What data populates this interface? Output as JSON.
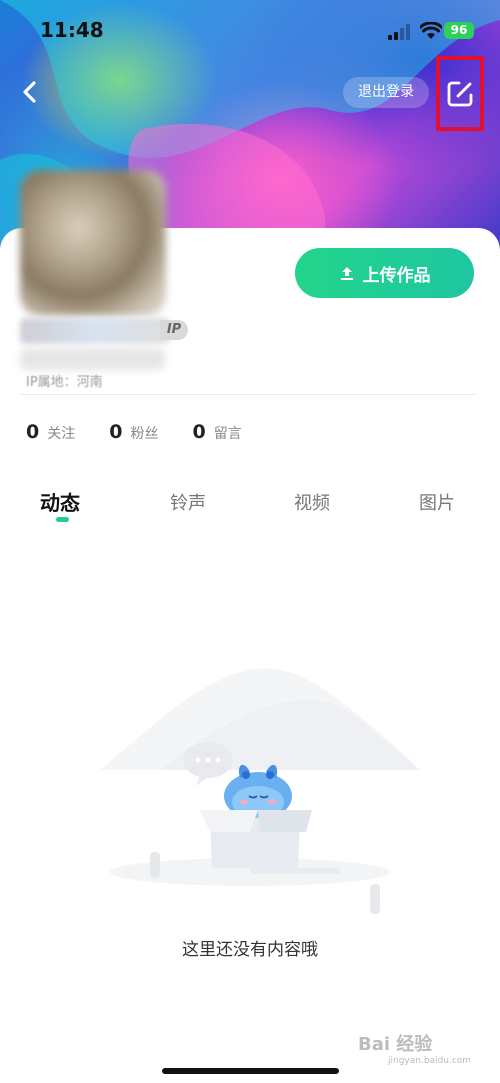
{
  "status_bar": {
    "time": "11:48",
    "battery": "96"
  },
  "header": {
    "logout_label": "退出登录"
  },
  "profile": {
    "upload_label": "上传作品",
    "vip_badge": "IP",
    "ip_location": "IP属地：河南",
    "stats": [
      {
        "value": "0",
        "label": "关注"
      },
      {
        "value": "0",
        "label": "粉丝"
      },
      {
        "value": "0",
        "label": "留言"
      }
    ]
  },
  "tabs": [
    {
      "label": "动态",
      "active": true
    },
    {
      "label": "铃声",
      "active": false
    },
    {
      "label": "视频",
      "active": false
    },
    {
      "label": "图片",
      "active": false
    }
  ],
  "empty_state": {
    "message": "这里还没有内容哦"
  },
  "watermark": {
    "text": "Bai 经验",
    "sub": "jingyan.baidu.com"
  },
  "colors": {
    "accent": "#1fcf8f",
    "highlight_box": "#e01030"
  }
}
